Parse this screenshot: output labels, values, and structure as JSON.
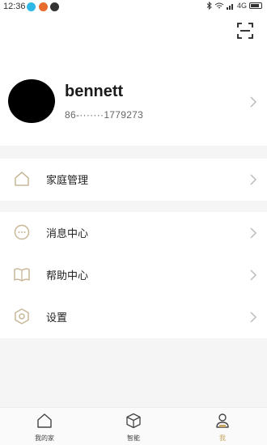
{
  "status_bar": {
    "time": "12:36",
    "network": "4G"
  },
  "header": {
    "scan_icon": "scan-icon"
  },
  "profile": {
    "username": "bennett",
    "phone": "86-·······1779273"
  },
  "menu": {
    "home_management": {
      "label": "家庭管理",
      "icon": "home-icon"
    },
    "message_center": {
      "label": "消息中心",
      "icon": "message-icon"
    },
    "help_center": {
      "label": "帮助中心",
      "icon": "book-icon"
    },
    "settings": {
      "label": "设置",
      "icon": "gear-icon"
    }
  },
  "tabbar": {
    "tabs": [
      {
        "label": "我的家",
        "icon": "home-icon"
      },
      {
        "label": "智能",
        "icon": "cube-icon"
      },
      {
        "label": "我",
        "icon": "user-icon",
        "active": true
      }
    ]
  },
  "colors": {
    "accent": "#c9a565",
    "icon_stroke": "#c8b797",
    "divider": "#f5f5f5"
  }
}
